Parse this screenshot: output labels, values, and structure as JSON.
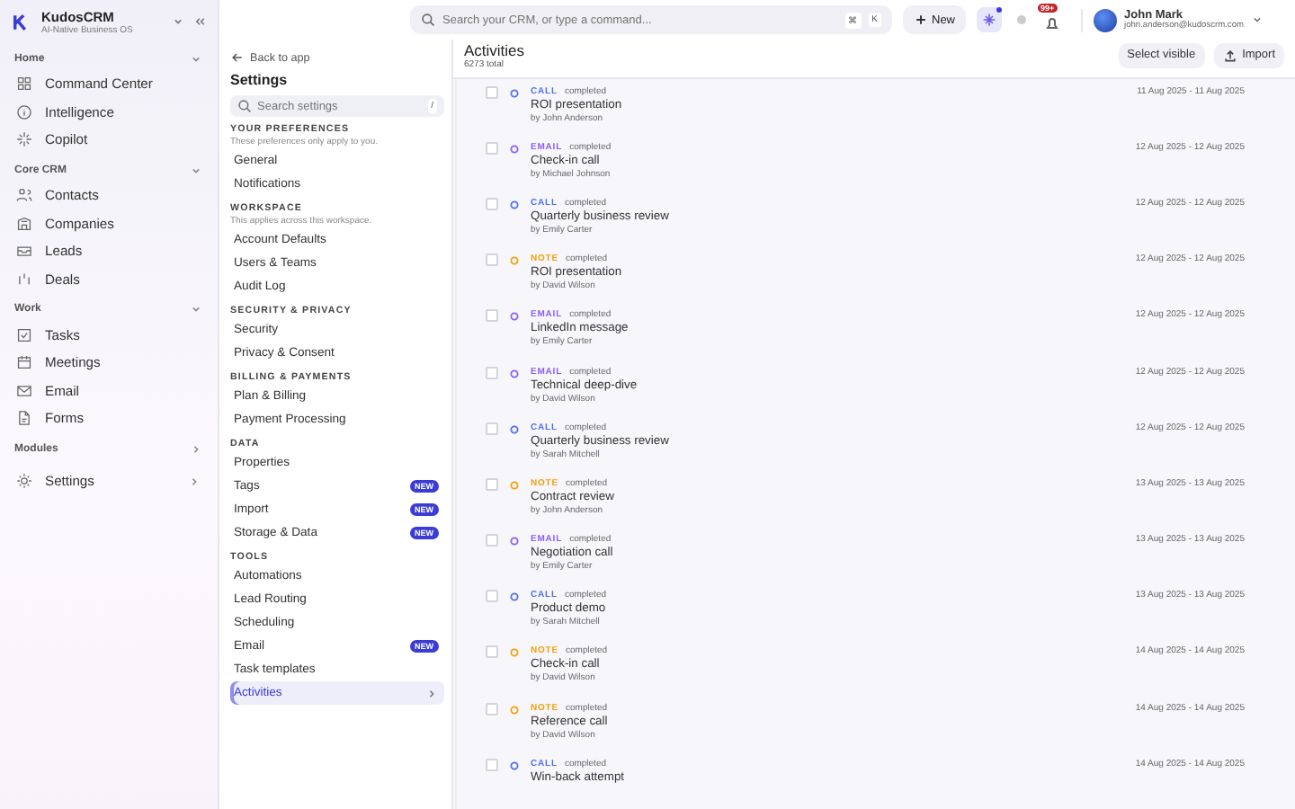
{
  "brand": {
    "name": "KudosCRM",
    "tagline": "AI-Native Business OS"
  },
  "sidebar": {
    "groups": [
      {
        "title": "Home",
        "expanded": true,
        "items": [
          {
            "label": "Command Center"
          },
          {
            "label": "Intelligence"
          },
          {
            "label": "Copilot"
          }
        ]
      },
      {
        "title": "Core CRM",
        "expanded": true,
        "items": [
          {
            "label": "Contacts"
          },
          {
            "label": "Companies"
          },
          {
            "label": "Leads"
          },
          {
            "label": "Deals"
          }
        ]
      },
      {
        "title": "Work",
        "expanded": true,
        "items": [
          {
            "label": "Tasks"
          },
          {
            "label": "Meetings"
          },
          {
            "label": "Email"
          },
          {
            "label": "Forms"
          }
        ]
      },
      {
        "title": "Modules",
        "expanded": false
      }
    ],
    "footer_item": {
      "label": "Settings"
    }
  },
  "topbar": {
    "search": {
      "placeholder": "Search your CRM, or type a command..."
    },
    "shortcut_keys": [
      "⌘",
      "K"
    ],
    "new_button": "New",
    "notification_badge": "99+",
    "user": {
      "name": "John Mark",
      "email": "john.anderson@kudoscrm.com"
    }
  },
  "settings": {
    "back": "Back to app",
    "title": "Settings",
    "search": {
      "placeholder": "Search settings",
      "shortcut": "/"
    },
    "sections": [
      {
        "title": "YOUR PREFERENCES",
        "description": "These preferences only apply to you.",
        "items": [
          {
            "label": "General",
            "selected": false
          },
          {
            "label": "Notifications",
            "selected": false
          }
        ]
      },
      {
        "title": "WORKSPACE",
        "description": "This applies across this workspace.",
        "items": [
          {
            "label": "Account Defaults",
            "selected": false
          },
          {
            "label": "Users & Teams",
            "selected": false
          },
          {
            "label": "Audit Log",
            "selected": false
          }
        ]
      },
      {
        "title": "SECURITY & PRIVACY",
        "items": [
          {
            "label": "Security",
            "selected": false
          },
          {
            "label": "Privacy & Consent",
            "selected": false
          }
        ]
      },
      {
        "title": "BILLING & PAYMENTS",
        "items": [
          {
            "label": "Plan & Billing",
            "selected": false
          },
          {
            "label": "Payment Processing",
            "selected": false
          }
        ]
      },
      {
        "title": "DATA",
        "items": [
          {
            "label": "Properties",
            "selected": false
          },
          {
            "label": "Tags",
            "badge": "NEW",
            "selected": false
          },
          {
            "label": "Import",
            "badge": "NEW",
            "selected": false
          },
          {
            "label": "Storage & Data",
            "badge": "NEW",
            "selected": false
          }
        ]
      },
      {
        "title": "TOOLS",
        "items": [
          {
            "label": "Automations",
            "selected": false
          },
          {
            "label": "Lead Routing",
            "selected": false
          },
          {
            "label": "Scheduling",
            "selected": false
          },
          {
            "label": "Email",
            "badge": "NEW",
            "selected": false
          },
          {
            "label": "Task templates",
            "selected": false
          },
          {
            "label": "Activities",
            "selected": true
          }
        ]
      }
    ]
  },
  "activities": {
    "title": "Activities",
    "total": "6273 total",
    "actions": [
      {
        "label": "Select visible",
        "kind": "plain"
      },
      {
        "label": "Import",
        "kind": "upload"
      }
    ],
    "rows": [
      {
        "type": "CALL",
        "kind": "call",
        "status": "completed",
        "title": "ROI presentation",
        "author": "by John Anderson",
        "dates": "11 Aug 2025 - 11 Aug 2025",
        "checked": false
      },
      {
        "type": "EMAIL",
        "kind": "email",
        "status": "completed",
        "title": "Check-in call",
        "author": "by Michael Johnson",
        "dates": "12 Aug 2025 - 12 Aug 2025",
        "checked": false
      },
      {
        "type": "CALL",
        "kind": "call",
        "status": "completed",
        "title": "Quarterly business review",
        "author": "by Emily Carter",
        "dates": "12 Aug 2025 - 12 Aug 2025",
        "checked": false
      },
      {
        "type": "NOTE",
        "kind": "note",
        "status": "completed",
        "title": "ROI presentation",
        "author": "by David Wilson",
        "dates": "12 Aug 2025 - 12 Aug 2025",
        "checked": false
      },
      {
        "type": "EMAIL",
        "kind": "email",
        "status": "completed",
        "title": "LinkedIn message",
        "author": "by Emily Carter",
        "dates": "12 Aug 2025 - 12 Aug 2025",
        "checked": false
      },
      {
        "type": "EMAIL",
        "kind": "email",
        "status": "completed",
        "title": "Technical deep-dive",
        "author": "by David Wilson",
        "dates": "12 Aug 2025 - 12 Aug 2025",
        "checked": false
      },
      {
        "type": "CALL",
        "kind": "call",
        "status": "completed",
        "title": "Quarterly business review",
        "author": "by Sarah Mitchell",
        "dates": "12 Aug 2025 - 12 Aug 2025",
        "checked": false
      },
      {
        "type": "NOTE",
        "kind": "note",
        "status": "completed",
        "title": "Contract review",
        "author": "by John Anderson",
        "dates": "13 Aug 2025 - 13 Aug 2025",
        "checked": false
      },
      {
        "type": "EMAIL",
        "kind": "email",
        "status": "completed",
        "title": "Negotiation call",
        "author": "by Emily Carter",
        "dates": "13 Aug 2025 - 13 Aug 2025",
        "checked": false
      },
      {
        "type": "CALL",
        "kind": "call",
        "status": "completed",
        "title": "Product demo",
        "author": "by Sarah Mitchell",
        "dates": "13 Aug 2025 - 13 Aug 2025",
        "checked": false
      },
      {
        "type": "NOTE",
        "kind": "note",
        "status": "completed",
        "title": "Check-in call",
        "author": "by David Wilson",
        "dates": "14 Aug 2025 - 14 Aug 2025",
        "checked": false
      },
      {
        "type": "NOTE",
        "kind": "note",
        "status": "completed",
        "title": "Reference call",
        "author": "by David Wilson",
        "dates": "14 Aug 2025 - 14 Aug 2025",
        "checked": false
      },
      {
        "type": "CALL",
        "kind": "call",
        "status": "completed",
        "title": "Win-back attempt",
        "dates": "14 Aug 2025 - 14 Aug 2025",
        "checked": false
      }
    ]
  }
}
